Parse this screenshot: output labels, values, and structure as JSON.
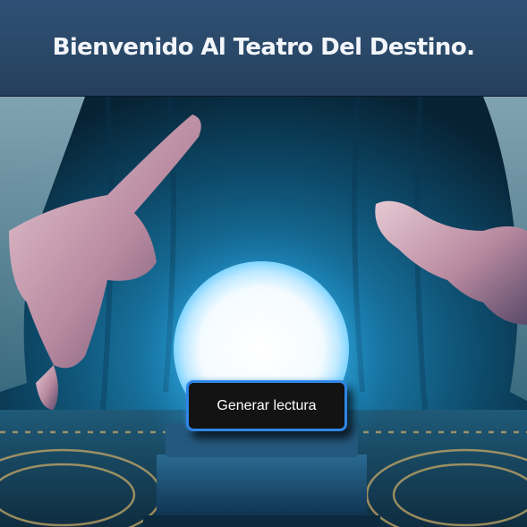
{
  "header": {
    "title": "Bienvenido Al Teatro Del Destino."
  },
  "hero": {
    "image_subject": "fortune-teller-hands-over-crystal-ball"
  },
  "actions": {
    "generate_label": "Generar lectura"
  },
  "colors": {
    "header_bg": "#2a4868",
    "title_text": "#f2f5f9",
    "button_bg": "#131313",
    "button_border": "#2f86e6",
    "button_text": "#ffffff",
    "orb_glow": "#4fd0ff"
  }
}
